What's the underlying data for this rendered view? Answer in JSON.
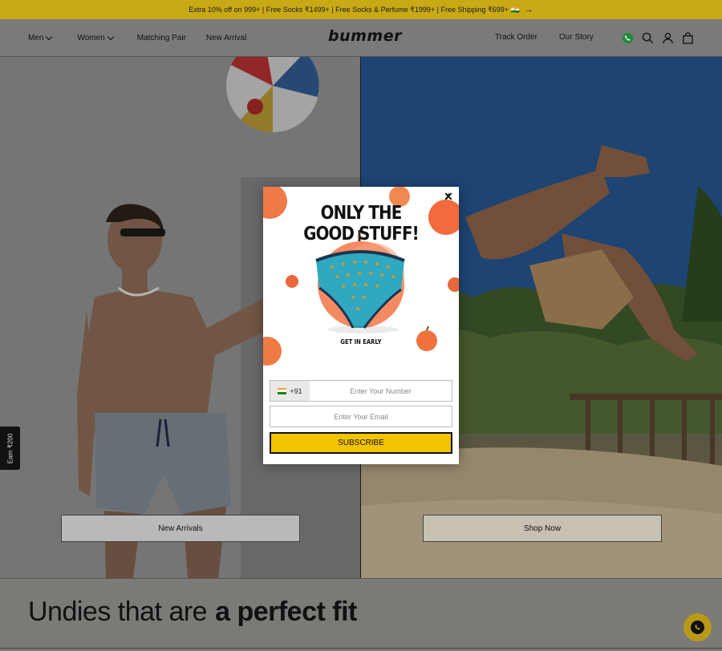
{
  "announcement": {
    "text": "Extra 10% off on 999+ | Free Socks ₹1499+ | Free Socks & Perfume ₹1999+ | Free Shipping ₹699+ 🇮🇳",
    "arrow": "→"
  },
  "header": {
    "logo": "bummer",
    "nav_left": [
      {
        "label": "Men",
        "has_dropdown": true
      },
      {
        "label": "Women",
        "has_dropdown": true
      },
      {
        "label": "Matching Pair",
        "has_dropdown": false
      },
      {
        "label": "New Arrival",
        "has_dropdown": false
      }
    ],
    "nav_right": {
      "track_order": "Track Order",
      "our_story": "Our Story"
    },
    "icons": [
      "whatsapp-icon",
      "search-icon",
      "account-icon",
      "cart-icon"
    ],
    "whatsapp_color": "#25d366"
  },
  "hero": {
    "left_cta": "New Arrivals",
    "right_cta": "Shop Now"
  },
  "earn_tab": "Earn ₹200",
  "tagline": {
    "regular": "Undies that are",
    "bold": "a perfect fit"
  },
  "popup": {
    "close": "✕",
    "headline_line1": "ONLY THE",
    "headline_line2": "GOOD STUFF!",
    "subheadline": "GET IN EARLY",
    "country_code": "+91",
    "phone_placeholder": "Enter Your Number",
    "email_placeholder": "Enter Your Email",
    "subscribe_label": "SUBSCRIBE",
    "accent_color": "#f2c300"
  }
}
